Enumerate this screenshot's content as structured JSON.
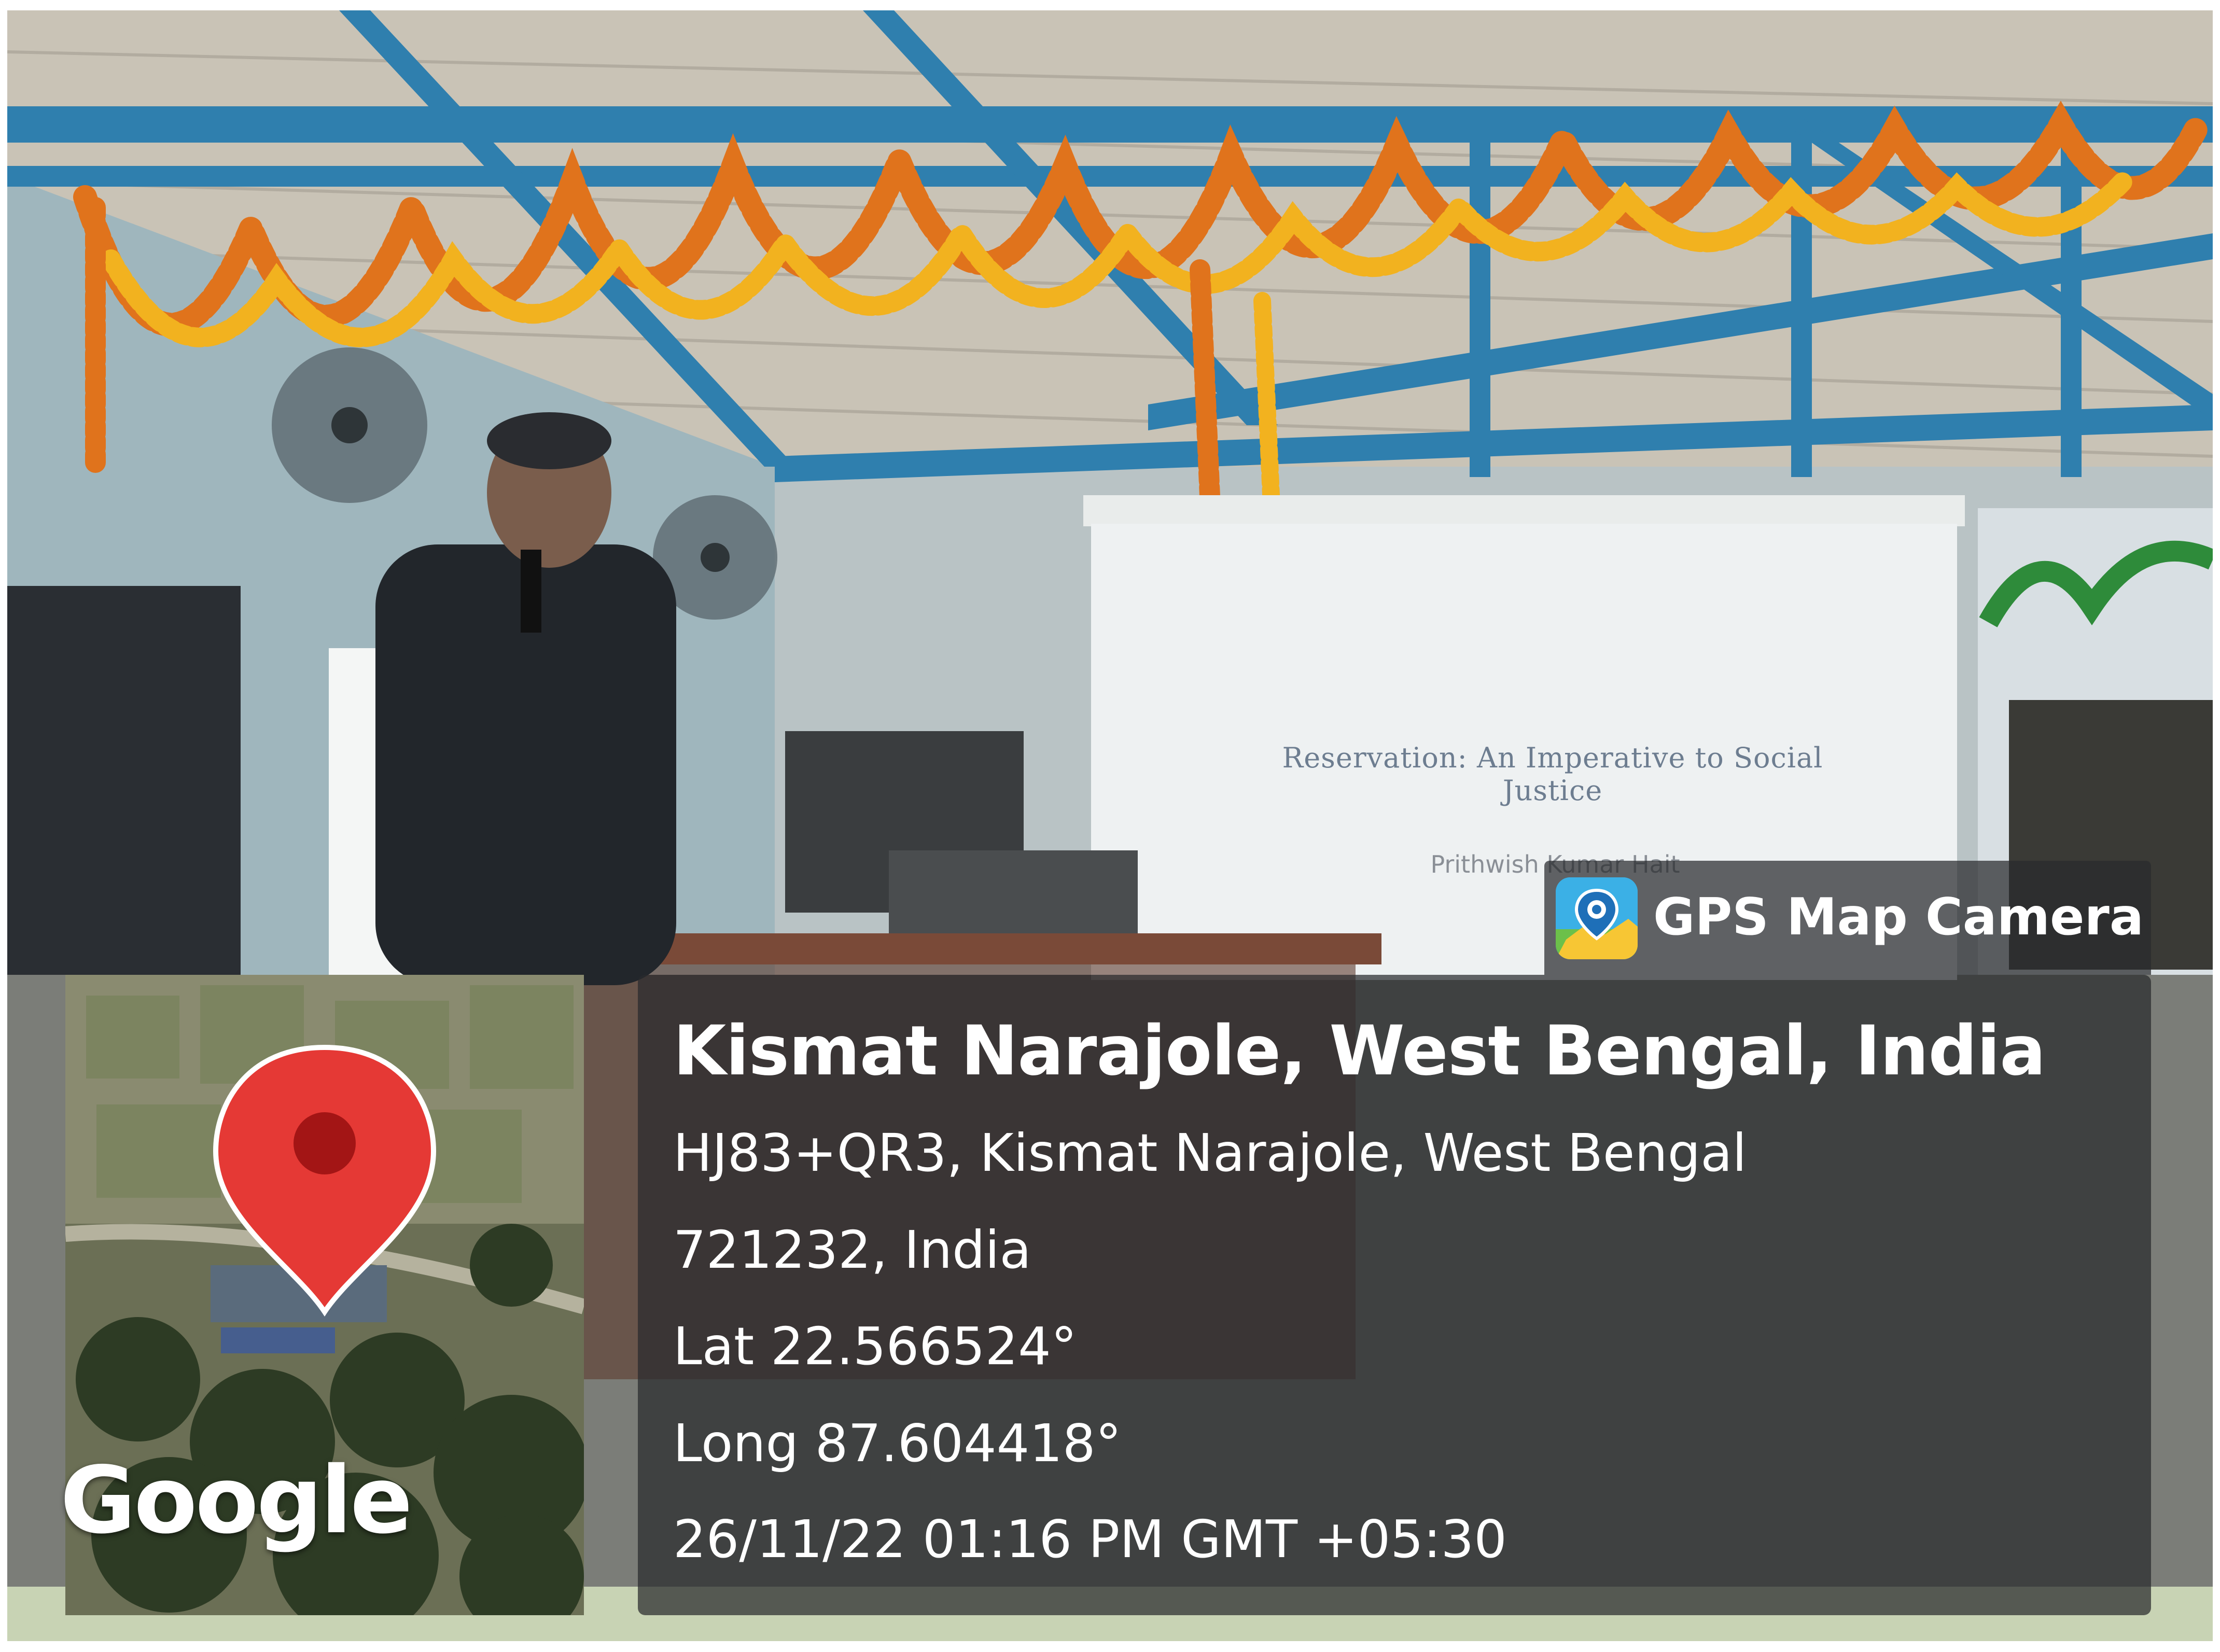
{
  "slide": {
    "title": "Reservation: An Imperative to Social Justice",
    "author": "Prithwish Kumar Hait"
  },
  "map": {
    "provider_logo": "Google",
    "pin_icon": "map-pin-icon",
    "pin_color": "#e53935"
  },
  "stamp": {
    "app_name": "GPS Map Camera",
    "app_icon": "gps-map-camera-icon",
    "place": "Kismat Narajole, West Bengal, India",
    "address_line1": "HJ83+QR3, Kismat Narajole, West Bengal",
    "address_line2": "721232, India",
    "latitude": "Lat 22.566524°",
    "longitude": "Long 87.604418°",
    "datetime": "26/11/22 01:16 PM GMT +05:30"
  },
  "colors": {
    "overlay": "#282a2c",
    "overlay_text": "#ffffff",
    "beam_blue": "#2f7fae",
    "garland_orange": "#e0731c",
    "garland_yellow": "#f2b21f"
  }
}
